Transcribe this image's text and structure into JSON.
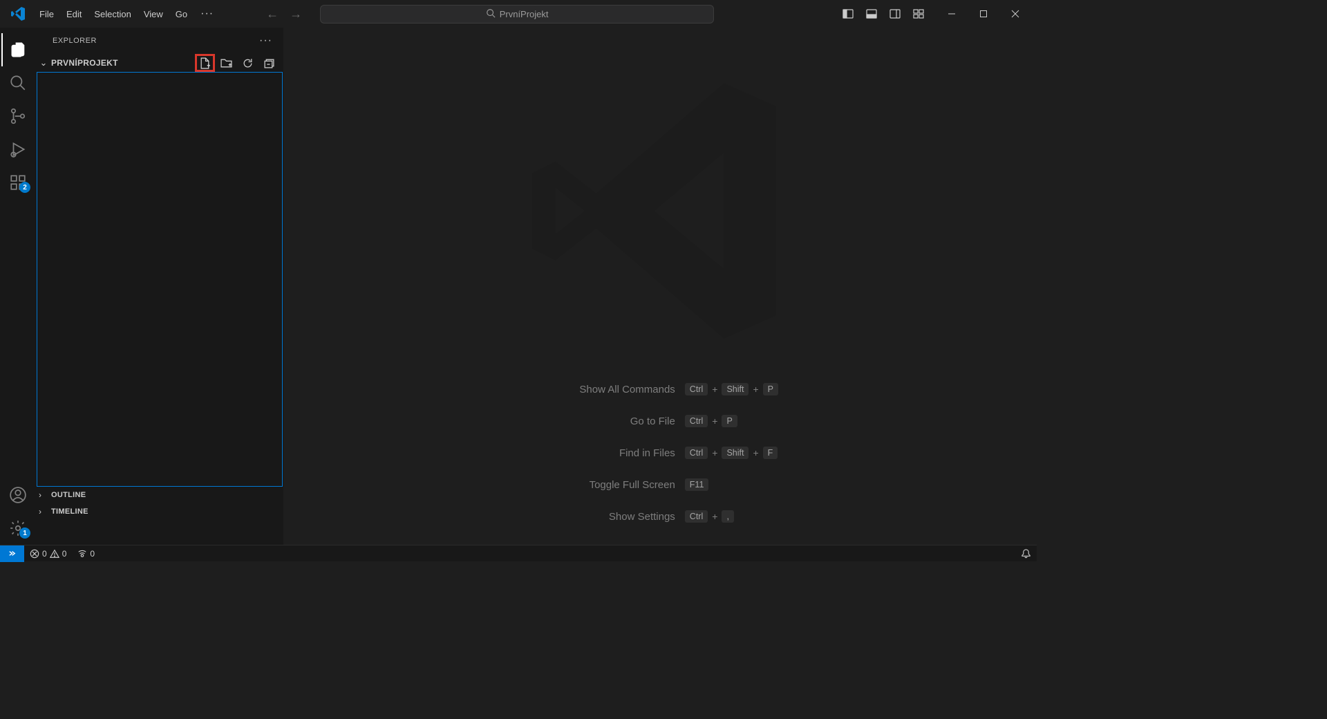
{
  "menu": {
    "file": "File",
    "edit": "Edit",
    "selection": "Selection",
    "view": "View",
    "go": "Go",
    "more": "···"
  },
  "search": {
    "text": "PrvníProjekt"
  },
  "activitybar": {
    "extensions_badge": "2",
    "settings_badge": "1"
  },
  "sidebar": {
    "title": "EXPLORER",
    "folder": "PRVNÍPROJEKT",
    "outline": "OUTLINE",
    "timeline": "TIMELINE"
  },
  "shortcuts": {
    "show_commands": "Show All Commands",
    "show_commands_keys": [
      "Ctrl",
      "Shift",
      "P"
    ],
    "go_to_file": "Go to File",
    "go_to_file_keys": [
      "Ctrl",
      "P"
    ],
    "find_in_files": "Find in Files",
    "find_keys": [
      "Ctrl",
      "Shift",
      "F"
    ],
    "fullscreen": "Toggle Full Screen",
    "fullscreen_keys": [
      "F11"
    ],
    "settings": "Show Settings",
    "settings_keys": [
      "Ctrl",
      ","
    ]
  },
  "statusbar": {
    "errors": "0",
    "warnings": "0",
    "ports": "0"
  }
}
